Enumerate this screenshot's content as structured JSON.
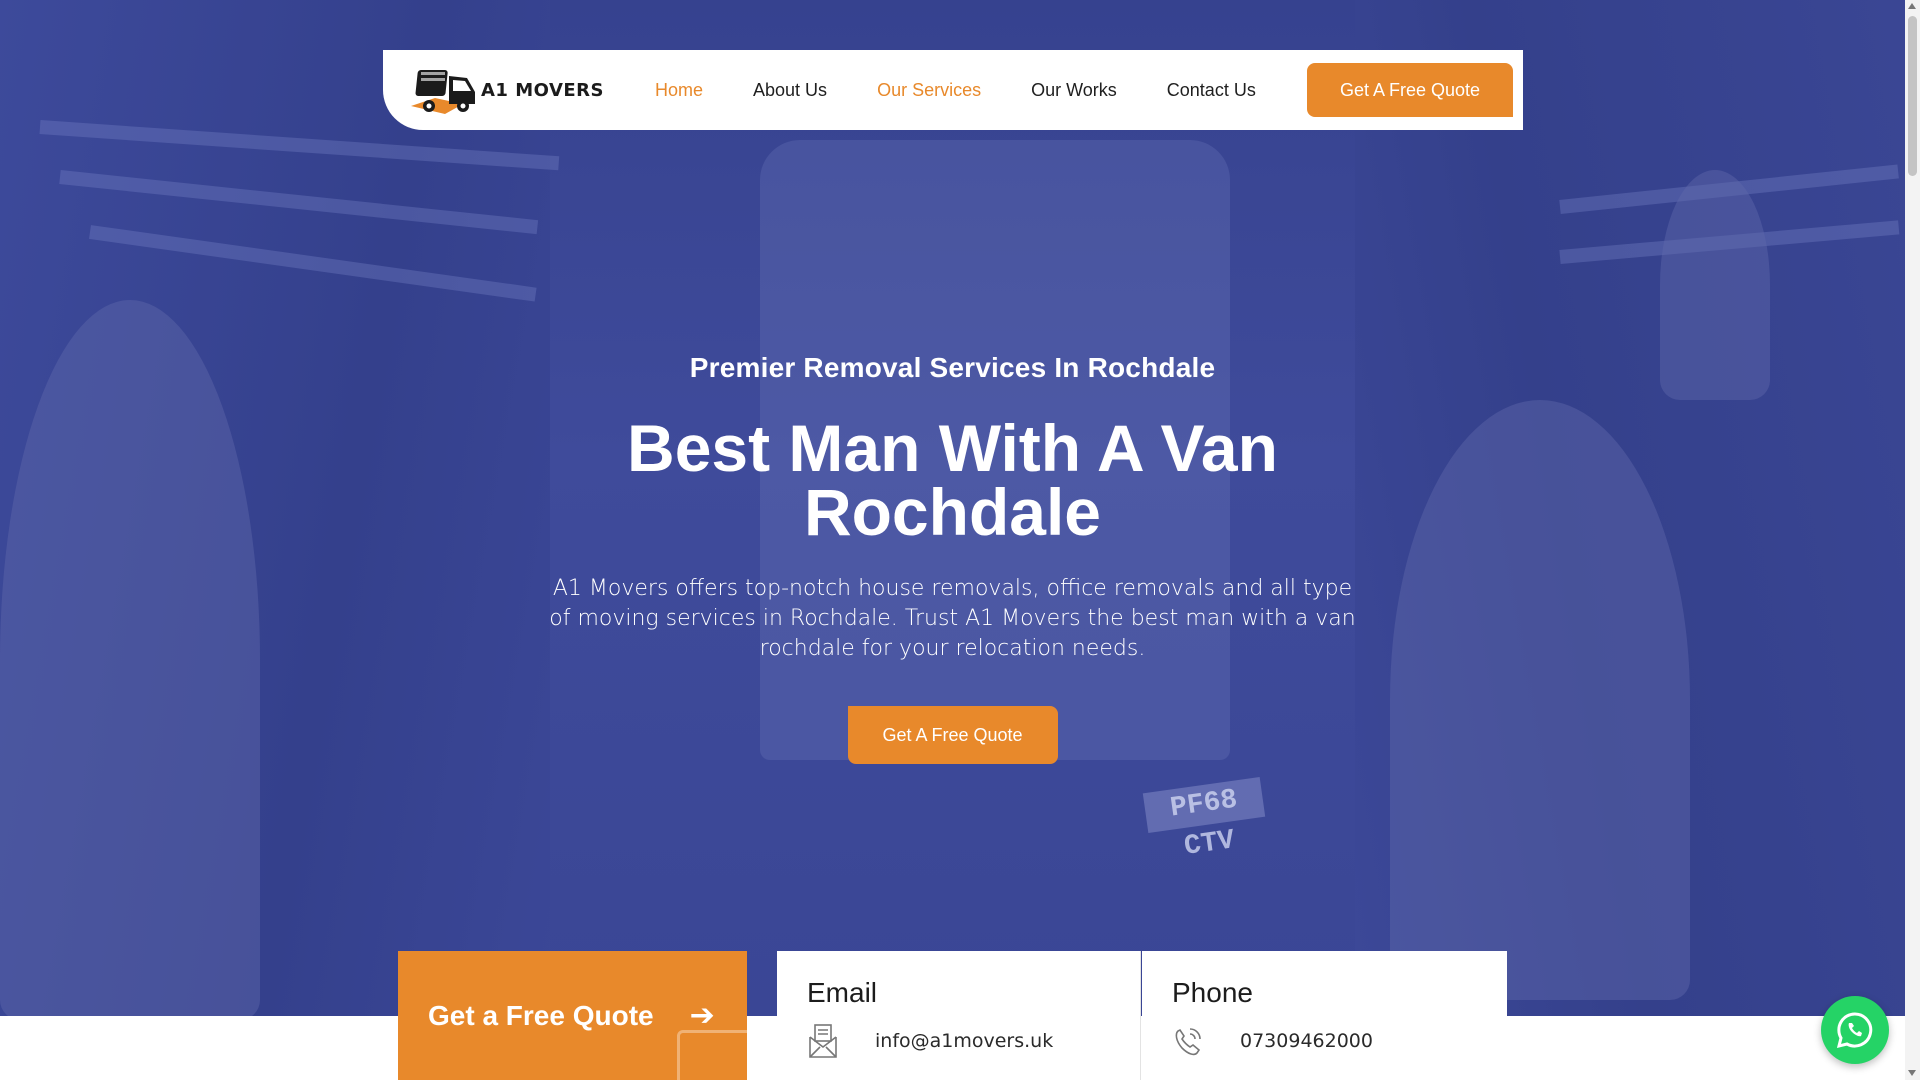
{
  "brand": {
    "logo_text": "A1 MOVERS",
    "accent_color": "#e8892b",
    "hero_overlay_color": "#3a4696"
  },
  "nav": {
    "items": [
      {
        "label": "Home",
        "active": true
      },
      {
        "label": "About Us",
        "active": false
      },
      {
        "label": "Our Services",
        "active": true
      },
      {
        "label": "Our Works",
        "active": false
      },
      {
        "label": "Contact Us",
        "active": false
      }
    ],
    "cta_label": "Get A Free Quote"
  },
  "hero": {
    "subtitle": "Premier Removal Services In Rochdale",
    "title_line1": "Best Man With A Van",
    "title_line2": "Rochdale",
    "description": "A1 Movers offers top-notch house removals, office removals and all type of moving services in Rochdale. Trust A1 Movers the best man with a van rochdale for your relocation needs.",
    "cta_label": "Get A Free Quote",
    "plate_text": "PF68 CTV"
  },
  "info_strip": {
    "quote_label": "Get a Free Quote",
    "quote_arrow_icon": "arrow-right-icon",
    "email": {
      "title": "Email",
      "value": "info@a1movers.uk",
      "icon": "envelope-icon"
    },
    "phone": {
      "title": "Phone",
      "value": "07309462000",
      "icon": "phone-icon"
    }
  },
  "floating": {
    "whatsapp_icon": "whatsapp-icon",
    "whatsapp_color": "#25d366"
  }
}
